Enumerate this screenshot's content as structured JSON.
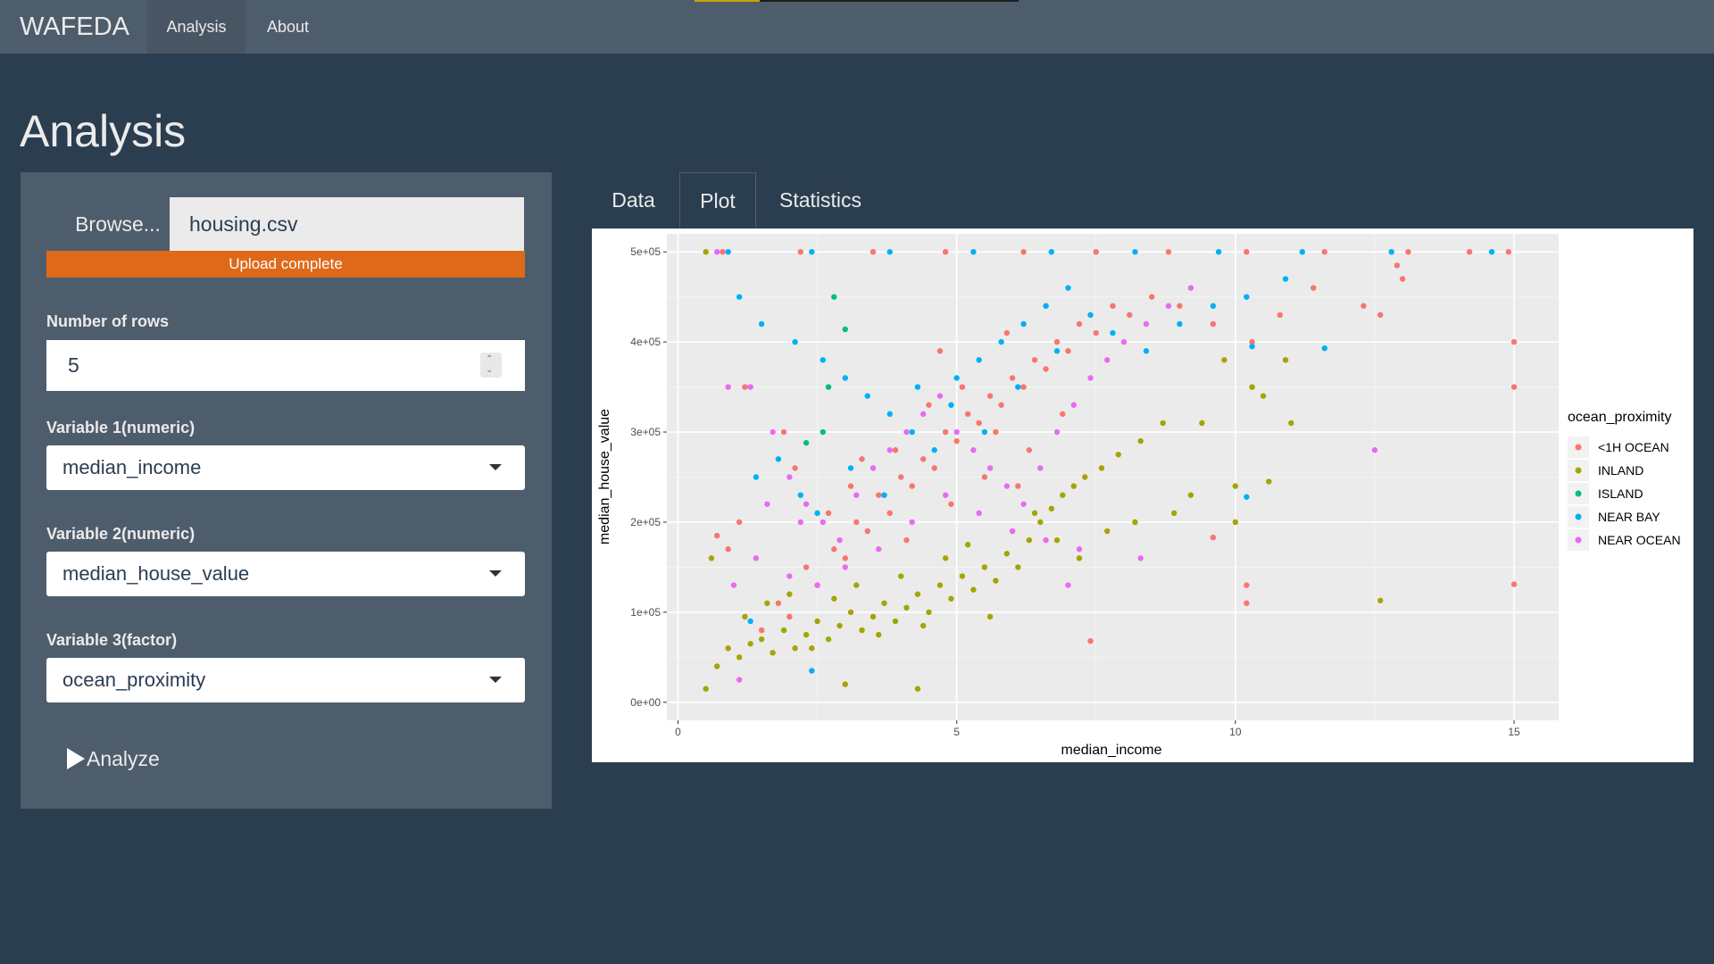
{
  "navbar": {
    "brand": "WAFEDA",
    "items": [
      {
        "label": "Analysis",
        "active": true
      },
      {
        "label": "About",
        "active": false
      }
    ]
  },
  "page_title": "Analysis",
  "sidebar": {
    "browse_label": "Browse...",
    "file_name": "housing.csv",
    "upload_status": "Upload complete",
    "rows_label": "Number of rows",
    "rows_value": "5",
    "var1_label": "Variable 1(numeric)",
    "var1_value": "median_income",
    "var2_label": "Variable 2(numeric)",
    "var2_value": "median_house_value",
    "var3_label": "Variable 3(factor)",
    "var3_value": "ocean_proximity",
    "analyze_label": "Analyze"
  },
  "tabs": [
    {
      "label": "Data",
      "active": false
    },
    {
      "label": "Plot",
      "active": true
    },
    {
      "label": "Statistics",
      "active": false
    }
  ],
  "colors": {
    "background": "#2b3e50",
    "navbar": "#4e5d6c",
    "upload_bar": "#df691a"
  },
  "chart_data": {
    "type": "scatter",
    "xlabel": "median_income",
    "ylabel": "median_house_value",
    "xlim": [
      -0.2,
      15.8
    ],
    "ylim": [
      -20000,
      520000
    ],
    "xticks": [
      0,
      5,
      10,
      15
    ],
    "xtick_labels": [
      "0",
      "5",
      "10",
      "15"
    ],
    "yticks": [
      0,
      100000,
      200000,
      300000,
      400000,
      500000
    ],
    "ytick_labels": [
      "0e+00",
      "1e+05",
      "2e+05",
      "3e+05",
      "4e+05",
      "5e+05"
    ],
    "grid": true,
    "legend": {
      "title": "ocean_proximity",
      "placement": "right",
      "entries": [
        "<1H OCEAN",
        "INLAND",
        "ISLAND",
        "NEAR BAY",
        "NEAR OCEAN"
      ]
    },
    "series": [
      {
        "name": "<1H OCEAN",
        "color": "#f8766d",
        "points": [
          [
            0.8,
            500000
          ],
          [
            2.2,
            500000
          ],
          [
            3.5,
            500000
          ],
          [
            4.8,
            500000
          ],
          [
            6.2,
            500000
          ],
          [
            7.5,
            500000
          ],
          [
            8.8,
            500000
          ],
          [
            10.2,
            500000
          ],
          [
            11.6,
            500000
          ],
          [
            13.1,
            500000
          ],
          [
            14.9,
            500000
          ],
          [
            15.0,
            400000
          ],
          [
            15.0,
            350000
          ],
          [
            15.0,
            131000
          ],
          [
            14.2,
            500000
          ],
          [
            1.5,
            80000
          ],
          [
            1.8,
            110000
          ],
          [
            2.0,
            95000
          ],
          [
            2.3,
            150000
          ],
          [
            2.5,
            130000
          ],
          [
            2.8,
            170000
          ],
          [
            3.0,
            160000
          ],
          [
            3.2,
            200000
          ],
          [
            3.4,
            190000
          ],
          [
            3.6,
            230000
          ],
          [
            3.8,
            210000
          ],
          [
            4.0,
            250000
          ],
          [
            4.2,
            240000
          ],
          [
            4.4,
            270000
          ],
          [
            4.6,
            260000
          ],
          [
            4.8,
            300000
          ],
          [
            5.0,
            290000
          ],
          [
            5.2,
            320000
          ],
          [
            5.4,
            310000
          ],
          [
            5.6,
            340000
          ],
          [
            5.8,
            330000
          ],
          [
            6.0,
            360000
          ],
          [
            6.2,
            350000
          ],
          [
            6.4,
            380000
          ],
          [
            6.6,
            370000
          ],
          [
            6.8,
            400000
          ],
          [
            7.0,
            390000
          ],
          [
            7.2,
            420000
          ],
          [
            7.5,
            410000
          ],
          [
            7.8,
            440000
          ],
          [
            8.1,
            430000
          ],
          [
            8.5,
            450000
          ],
          [
            9.0,
            440000
          ],
          [
            9.6,
            420000
          ],
          [
            10.3,
            400000
          ],
          [
            10.9,
            380000
          ],
          [
            10.8,
            430000
          ],
          [
            11.4,
            460000
          ],
          [
            12.3,
            440000
          ],
          [
            12.6,
            430000
          ],
          [
            13.0,
            470000
          ],
          [
            12.9,
            485000
          ],
          [
            3.1,
            240000
          ],
          [
            3.9,
            280000
          ],
          [
            4.5,
            330000
          ],
          [
            5.1,
            350000
          ],
          [
            5.7,
            300000
          ],
          [
            6.3,
            280000
          ],
          [
            6.9,
            320000
          ],
          [
            2.7,
            210000
          ],
          [
            4.1,
            180000
          ],
          [
            4.9,
            220000
          ],
          [
            5.5,
            250000
          ],
          [
            6.1,
            240000
          ],
          [
            3.3,
            270000
          ],
          [
            4.7,
            390000
          ],
          [
            5.9,
            410000
          ],
          [
            2.1,
            260000
          ],
          [
            1.2,
            350000
          ],
          [
            1.9,
            300000
          ],
          [
            0.7,
            185000
          ],
          [
            0.9,
            170000
          ],
          [
            1.1,
            200000
          ],
          [
            7.4,
            68000
          ],
          [
            9.6,
            183000
          ],
          [
            10.2,
            130000
          ],
          [
            10.2,
            110000
          ],
          [
            6.6,
            440000
          ]
        ]
      },
      {
        "name": "INLAND",
        "color": "#a3a500",
        "points": [
          [
            0.5,
            500000
          ],
          [
            0.6,
            160000
          ],
          [
            0.7,
            40000
          ],
          [
            0.9,
            60000
          ],
          [
            1.1,
            50000
          ],
          [
            1.3,
            65000
          ],
          [
            1.5,
            70000
          ],
          [
            1.7,
            55000
          ],
          [
            1.9,
            80000
          ],
          [
            2.1,
            60000
          ],
          [
            2.3,
            75000
          ],
          [
            2.5,
            90000
          ],
          [
            2.7,
            70000
          ],
          [
            2.9,
            85000
          ],
          [
            3.1,
            100000
          ],
          [
            3.3,
            80000
          ],
          [
            3.5,
            95000
          ],
          [
            3.7,
            110000
          ],
          [
            3.9,
            90000
          ],
          [
            4.1,
            105000
          ],
          [
            4.3,
            120000
          ],
          [
            4.5,
            100000
          ],
          [
            4.7,
            130000
          ],
          [
            4.9,
            115000
          ],
          [
            5.1,
            140000
          ],
          [
            5.3,
            125000
          ],
          [
            5.5,
            150000
          ],
          [
            5.7,
            135000
          ],
          [
            5.9,
            165000
          ],
          [
            6.1,
            150000
          ],
          [
            6.3,
            180000
          ],
          [
            6.5,
            200000
          ],
          [
            6.7,
            215000
          ],
          [
            6.9,
            230000
          ],
          [
            7.1,
            240000
          ],
          [
            7.3,
            250000
          ],
          [
            7.6,
            260000
          ],
          [
            7.9,
            275000
          ],
          [
            8.3,
            290000
          ],
          [
            8.7,
            310000
          ],
          [
            1.2,
            95000
          ],
          [
            1.6,
            110000
          ],
          [
            2.0,
            120000
          ],
          [
            2.4,
            60000
          ],
          [
            2.8,
            115000
          ],
          [
            3.2,
            130000
          ],
          [
            3.6,
            75000
          ],
          [
            4.0,
            140000
          ],
          [
            4.4,
            85000
          ],
          [
            4.8,
            160000
          ],
          [
            5.2,
            175000
          ],
          [
            5.6,
            95000
          ],
          [
            6.0,
            190000
          ],
          [
            6.4,
            210000
          ],
          [
            6.8,
            180000
          ],
          [
            7.2,
            160000
          ],
          [
            7.7,
            190000
          ],
          [
            8.2,
            200000
          ],
          [
            8.9,
            210000
          ],
          [
            9.2,
            230000
          ],
          [
            9.4,
            310000
          ],
          [
            9.8,
            380000
          ],
          [
            10.0,
            240000
          ],
          [
            10.0,
            200000
          ],
          [
            10.3,
            350000
          ],
          [
            10.5,
            340000
          ],
          [
            10.6,
            245000
          ],
          [
            11.0,
            310000
          ],
          [
            10.9,
            380000
          ],
          [
            12.6,
            113000
          ],
          [
            4.3,
            15000
          ],
          [
            0.5,
            15000
          ],
          [
            3.0,
            20000
          ]
        ]
      },
      {
        "name": "ISLAND",
        "color": "#00bf7d",
        "points": [
          [
            2.8,
            450000
          ],
          [
            3.0,
            414000
          ],
          [
            2.3,
            288000
          ],
          [
            2.6,
            300000
          ],
          [
            2.7,
            350000
          ]
        ]
      },
      {
        "name": "NEAR BAY",
        "color": "#00b0f6",
        "points": [
          [
            0.9,
            500000
          ],
          [
            2.4,
            500000
          ],
          [
            3.8,
            500000
          ],
          [
            5.3,
            500000
          ],
          [
            6.7,
            500000
          ],
          [
            8.2,
            500000
          ],
          [
            9.7,
            500000
          ],
          [
            11.2,
            500000
          ],
          [
            12.8,
            500000
          ],
          [
            14.6,
            500000
          ],
          [
            1.1,
            450000
          ],
          [
            1.5,
            420000
          ],
          [
            2.1,
            400000
          ],
          [
            2.6,
            380000
          ],
          [
            3.0,
            360000
          ],
          [
            3.4,
            340000
          ],
          [
            3.8,
            320000
          ],
          [
            4.2,
            300000
          ],
          [
            4.6,
            280000
          ],
          [
            5.0,
            360000
          ],
          [
            5.4,
            380000
          ],
          [
            5.8,
            400000
          ],
          [
            6.2,
            420000
          ],
          [
            6.6,
            440000
          ],
          [
            7.0,
            460000
          ],
          [
            7.4,
            430000
          ],
          [
            7.8,
            410000
          ],
          [
            8.4,
            390000
          ],
          [
            9.0,
            420000
          ],
          [
            9.6,
            440000
          ],
          [
            10.2,
            450000
          ],
          [
            10.9,
            470000
          ],
          [
            11.6,
            393000
          ],
          [
            10.3,
            395000
          ],
          [
            10.2,
            228000
          ],
          [
            1.4,
            250000
          ],
          [
            1.8,
            270000
          ],
          [
            2.2,
            230000
          ],
          [
            2.5,
            210000
          ],
          [
            3.1,
            260000
          ],
          [
            3.7,
            230000
          ],
          [
            4.3,
            350000
          ],
          [
            4.9,
            330000
          ],
          [
            5.5,
            300000
          ],
          [
            6.1,
            350000
          ],
          [
            6.8,
            390000
          ],
          [
            1.3,
            90000
          ],
          [
            2.4,
            35000
          ]
        ]
      },
      {
        "name": "NEAR OCEAN",
        "color": "#e76bf3",
        "points": [
          [
            0.7,
            500000
          ],
          [
            1.3,
            350000
          ],
          [
            0.9,
            350000
          ],
          [
            1.7,
            300000
          ],
          [
            2.0,
            250000
          ],
          [
            2.3,
            220000
          ],
          [
            2.6,
            200000
          ],
          [
            2.9,
            180000
          ],
          [
            3.2,
            230000
          ],
          [
            3.5,
            260000
          ],
          [
            3.8,
            280000
          ],
          [
            4.1,
            300000
          ],
          [
            4.4,
            320000
          ],
          [
            4.7,
            340000
          ],
          [
            5.0,
            300000
          ],
          [
            5.3,
            280000
          ],
          [
            5.6,
            260000
          ],
          [
            5.9,
            240000
          ],
          [
            6.2,
            220000
          ],
          [
            6.5,
            260000
          ],
          [
            6.8,
            300000
          ],
          [
            7.1,
            330000
          ],
          [
            7.4,
            360000
          ],
          [
            7.7,
            380000
          ],
          [
            8.0,
            400000
          ],
          [
            8.4,
            420000
          ],
          [
            8.8,
            440000
          ],
          [
            9.2,
            460000
          ],
          [
            3.0,
            150000
          ],
          [
            3.6,
            170000
          ],
          [
            4.2,
            200000
          ],
          [
            4.8,
            230000
          ],
          [
            5.4,
            210000
          ],
          [
            6.0,
            190000
          ],
          [
            6.6,
            180000
          ],
          [
            7.2,
            170000
          ],
          [
            1.0,
            130000
          ],
          [
            1.4,
            160000
          ],
          [
            2.0,
            140000
          ],
          [
            2.5,
            130000
          ],
          [
            2.2,
            200000
          ],
          [
            1.6,
            220000
          ],
          [
            12.5,
            280000
          ],
          [
            8.3,
            160000
          ],
          [
            7.0,
            130000
          ],
          [
            1.1,
            25000
          ]
        ]
      }
    ]
  }
}
